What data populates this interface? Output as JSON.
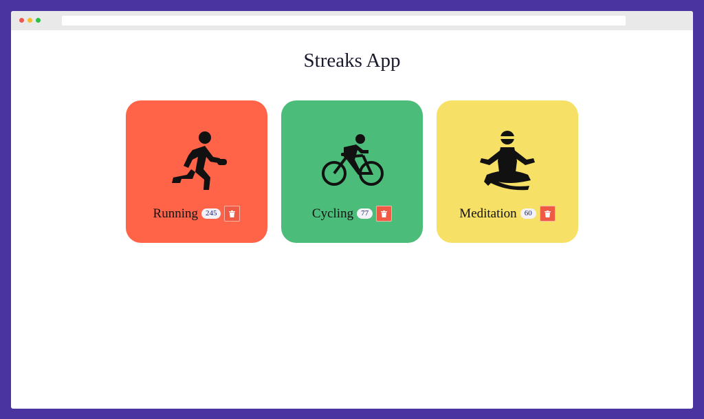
{
  "app": {
    "title": "Streaks App"
  },
  "colors": {
    "running": "#ff6348",
    "cycling": "#4cbc7a",
    "meditation": "#f6e065",
    "delete": "#ef5a45"
  },
  "streaks": [
    {
      "name": "Running",
      "count": "245",
      "icon": "running-person-icon"
    },
    {
      "name": "Cycling",
      "count": "77",
      "icon": "cyclist-icon"
    },
    {
      "name": "Meditation",
      "count": "60",
      "icon": "meditation-person-icon"
    }
  ],
  "delete_icon": "trash-icon"
}
